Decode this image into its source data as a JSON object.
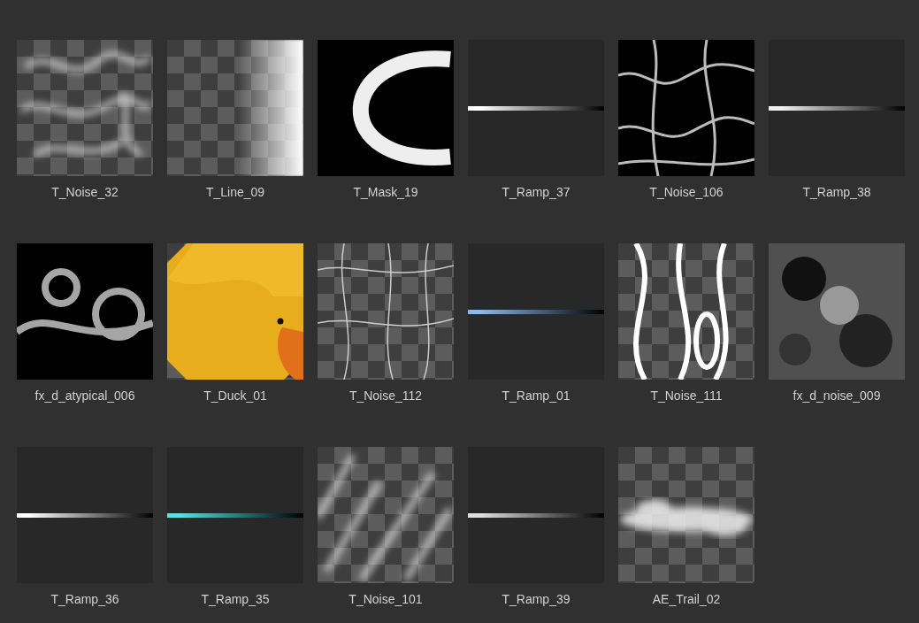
{
  "assets": [
    {
      "label": "T_Noise_32",
      "kind": "smoke"
    },
    {
      "label": "T_Line_09",
      "kind": "edge"
    },
    {
      "label": "T_Mask_19",
      "kind": "mask"
    },
    {
      "label": "T_Ramp_37",
      "kind": "ramp",
      "color": "#ffffff"
    },
    {
      "label": "T_Noise_106",
      "kind": "cells"
    },
    {
      "label": "T_Ramp_38",
      "kind": "ramp",
      "color": "#f0f0f0"
    },
    {
      "label": "fx_d_atypical_006",
      "kind": "smoke-dark"
    },
    {
      "label": "T_Duck_01",
      "kind": "duck"
    },
    {
      "label": "T_Noise_112",
      "kind": "lines"
    },
    {
      "label": "T_Ramp_01",
      "kind": "ramp",
      "color": "#8fb8e8"
    },
    {
      "label": "T_Noise_111",
      "kind": "veins"
    },
    {
      "label": "fx_d_noise_009",
      "kind": "blur"
    },
    {
      "label": "T_Ramp_36",
      "kind": "ramp",
      "color": "#ffffff"
    },
    {
      "label": "T_Ramp_35",
      "kind": "ramp",
      "color": "#5ce0e0"
    },
    {
      "label": "T_Noise_101",
      "kind": "streaks"
    },
    {
      "label": "T_Ramp_39",
      "kind": "ramp",
      "color": "#e0e0e0"
    },
    {
      "label": "AE_Trail_02",
      "kind": "trail"
    }
  ]
}
